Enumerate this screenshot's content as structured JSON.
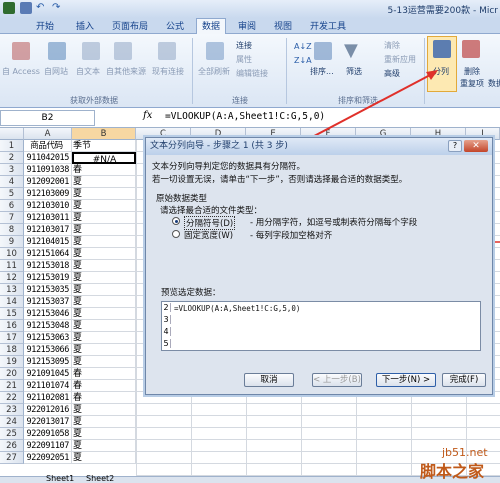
{
  "window": {
    "title": "5-13运营需要200款 - Micr"
  },
  "tabs": [
    "开始",
    "插入",
    "页面布局",
    "公式",
    "数据",
    "审阅",
    "视图",
    "开发工具"
  ],
  "active_tab": "数据",
  "ribbon": {
    "external": {
      "items": [
        "自 Access",
        "自网站",
        "自文本",
        "自其他来源",
        "现有连接"
      ],
      "group": "获取外部数据"
    },
    "connections": {
      "refresh": "全部刷新",
      "side": [
        "连接",
        "属性",
        "编辑链接"
      ],
      "group": "连接"
    },
    "sort": {
      "sort": "排序...",
      "filter": "筛选",
      "side": [
        "清除",
        "重新应用",
        "高级"
      ],
      "group": "排序和筛选"
    },
    "tools": {
      "split": "分列",
      "dedupe_1": "删除",
      "dedupe_2": "重复项",
      "partial": "数据有"
    }
  },
  "formula_bar": {
    "cell": "B2",
    "fx": "fx",
    "formula": "=VLOOKUP(A:A,Sheet1!C:G,5,0)"
  },
  "columns": [
    "A",
    "B",
    "C",
    "D",
    "E",
    "F",
    "G",
    "H",
    "I"
  ],
  "header_row": {
    "a": "商品代码",
    "b": "季节"
  },
  "rows": [
    {
      "n": "1"
    },
    {
      "n": "2",
      "a": "911042015",
      "b": "#N/A"
    },
    {
      "n": "3",
      "a": "911091038",
      "b": "春"
    },
    {
      "n": "4",
      "a": "912092001",
      "b": "夏"
    },
    {
      "n": "5",
      "a": "912103009",
      "b": "夏"
    },
    {
      "n": "6",
      "a": "912103010",
      "b": "夏"
    },
    {
      "n": "7",
      "a": "912103011",
      "b": "夏"
    },
    {
      "n": "8",
      "a": "912103017",
      "b": "夏"
    },
    {
      "n": "9",
      "a": "912104015",
      "b": "夏"
    },
    {
      "n": "10",
      "a": "912151064",
      "b": "夏"
    },
    {
      "n": "11",
      "a": "912153018",
      "b": "夏"
    },
    {
      "n": "12",
      "a": "912153019",
      "b": "夏"
    },
    {
      "n": "13",
      "a": "912153035",
      "b": "夏"
    },
    {
      "n": "14",
      "a": "912153037",
      "b": "夏"
    },
    {
      "n": "15",
      "a": "912153046",
      "b": "夏"
    },
    {
      "n": "16",
      "a": "912153048",
      "b": "夏"
    },
    {
      "n": "17",
      "a": "912153063",
      "b": "夏"
    },
    {
      "n": "18",
      "a": "912153066",
      "b": "夏"
    },
    {
      "n": "19",
      "a": "912153095",
      "b": "夏"
    },
    {
      "n": "20",
      "a": "921091045",
      "b": "春"
    },
    {
      "n": "21",
      "a": "921101074",
      "b": "春"
    },
    {
      "n": "22",
      "a": "921102081",
      "b": "春"
    },
    {
      "n": "23",
      "a": "922012016",
      "b": "夏"
    },
    {
      "n": "24",
      "a": "922013017",
      "b": "夏"
    },
    {
      "n": "25",
      "a": "922091058",
      "b": "夏"
    },
    {
      "n": "26",
      "a": "922091107",
      "b": "夏"
    },
    {
      "n": "27",
      "a": "922092051",
      "b": "夏"
    }
  ],
  "dialog": {
    "title": "文本分列向导 - 步骤之 1 (共 3 步)",
    "line1": "文本分列向导判定您的数据具有分隔符。",
    "line2": "若一切设置无误，请单击“下一步”，否则请选择最合适的数据类型。",
    "section": "原始数据类型",
    "prompt": "请选择最合适的文件类型：",
    "opt1_label": "分隔符号(D)",
    "opt1_desc": "- 用分隔字符，如逗号或制表符分隔每个字段",
    "opt2_label": "固定宽度(W)",
    "opt2_desc": "- 每列字段加空格对齐",
    "preview_label": "预览选定数据：",
    "preview_lines": [
      "=VLOOKUP(A:A,Sheet1!C:G,5,0)",
      "",
      "",
      ""
    ],
    "preview_nums": [
      "2",
      "3",
      "4",
      "5"
    ],
    "buttons": {
      "cancel": "取消",
      "back": "< 上一步(B)",
      "next": "下一步(N) >",
      "finish": "完成(F)"
    }
  },
  "sheets": [
    "Sheet1",
    "Sheet2"
  ],
  "watermark": {
    "site": "jb51.net",
    "brand": "脚本之家"
  },
  "colors": {
    "arrow": "#e0302a",
    "selection": "#000000"
  }
}
